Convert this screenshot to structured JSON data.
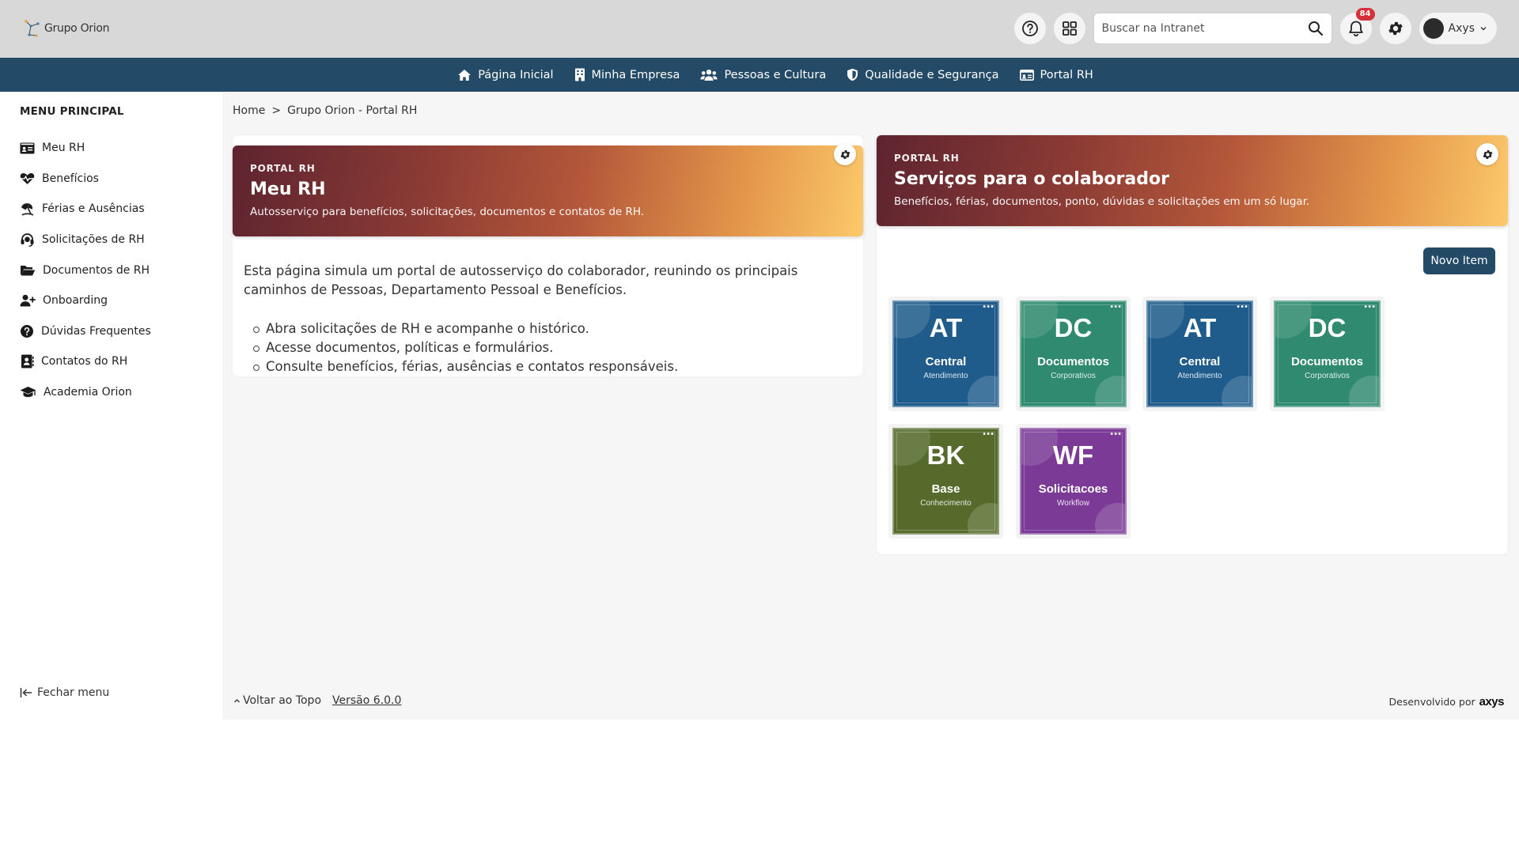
{
  "header": {
    "logo_text": "Grupo Orion",
    "search_placeholder": "Buscar na Intranet",
    "notifications_count": "84",
    "user_name": "Axys"
  },
  "nav": {
    "items": [
      {
        "label": "Página Inicial",
        "icon": "home-icon"
      },
      {
        "label": "Minha Empresa",
        "icon": "building-icon"
      },
      {
        "label": "Pessoas e Cultura",
        "icon": "users-icon"
      },
      {
        "label": "Qualidade e Segurança",
        "icon": "shield-icon"
      },
      {
        "label": "Portal RH",
        "icon": "id-card-icon"
      }
    ]
  },
  "sidebar": {
    "title": "MENU PRINCIPAL",
    "items": [
      {
        "label": "Meu RH",
        "icon": "id-card-icon"
      },
      {
        "label": "Benefícios",
        "icon": "heart-pulse-icon"
      },
      {
        "label": "Férias e Ausências",
        "icon": "umbrella-beach-icon"
      },
      {
        "label": "Solicitações de RH",
        "icon": "headset-icon"
      },
      {
        "label": "Documentos de RH",
        "icon": "folder-open-icon"
      },
      {
        "label": "Onboarding",
        "icon": "user-plus-icon"
      },
      {
        "label": "Dúvidas Frequentes",
        "icon": "question-circle-icon"
      },
      {
        "label": "Contatos do RH",
        "icon": "address-book-icon"
      },
      {
        "label": "Academia Orion",
        "icon": "graduation-cap-icon"
      }
    ],
    "close_label": "Fechar menu"
  },
  "breadcrumb": {
    "home": "Home",
    "separator": ">",
    "current": "Grupo Orion - Portal RH"
  },
  "left_panel": {
    "kicker": "PORTAL RH",
    "title": "Meu RH",
    "subtitle": "Autosserviço para benefícios, solicitações, documentos e contatos de RH.",
    "intro": "Esta página simula um portal de autosserviço do colaborador, reunindo os principais caminhos de Pessoas, Departamento Pessoal e Benefícios.",
    "bullets": [
      "Abra solicitações de RH e acompanhe o histórico.",
      "Acesse documentos, políticas e formulários.",
      "Consulte benefícios, férias, ausências e contatos responsáveis."
    ]
  },
  "right_panel": {
    "kicker": "PORTAL RH",
    "title": "Serviços para o colaborador",
    "subtitle": "Benefícios, férias, documentos, ponto, dúvidas e solicitações em um só lugar.",
    "new_item_label": "Novo Item",
    "tiles": [
      {
        "abbr": "AT",
        "name": "Central",
        "sub": "Atendimento",
        "color": "#1f5c8c"
      },
      {
        "abbr": "DC",
        "name": "Documentos",
        "sub": "Corporativos",
        "color": "#2f8a6f"
      },
      {
        "abbr": "AT",
        "name": "Central",
        "sub": "Atendimento",
        "color": "#1f5c8c"
      },
      {
        "abbr": "DC",
        "name": "Documentos",
        "sub": "Corporativos",
        "color": "#2f8a6f"
      },
      {
        "abbr": "BK",
        "name": "Base",
        "sub": "Conhecimento",
        "color": "#566a2b"
      },
      {
        "abbr": "WF",
        "name": "Solicitacoes",
        "sub": "Workflow",
        "color": "#7a3a96"
      }
    ],
    "tile_menu_glyph": "•••"
  },
  "footer": {
    "back_to_top": "Voltar ao Topo",
    "version": "Versão 6.0.0",
    "developed_by": "Desenvolvido por",
    "brand": "axys"
  }
}
